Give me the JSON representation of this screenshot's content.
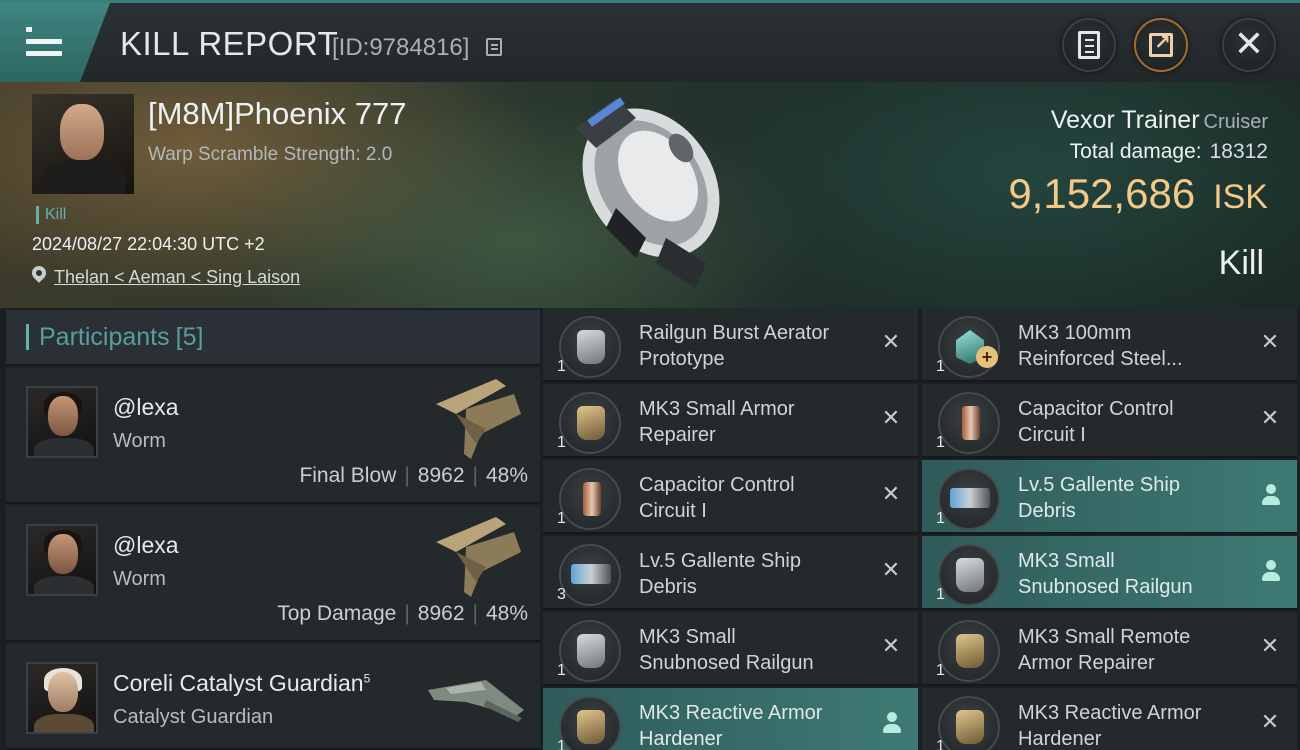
{
  "header": {
    "title": "KILL REPORT",
    "report_id": "[ID:9784816]"
  },
  "victim": {
    "name": "[M8M]Phoenix 777",
    "warp_scramble": "Warp Scramble Strength: 2.0",
    "tag": "Kill",
    "datetime": "2024/08/27 22:04:30 UTC +2",
    "location": "Thelan < Aeman < Sing Laison",
    "ship": "Vexor Trainer",
    "ship_class": "Cruiser",
    "total_damage_label": "Total damage:",
    "total_damage": "18312",
    "isk_value": "9,152,686",
    "isk_unit": "ISK",
    "result": "Kill"
  },
  "participants": {
    "label": "Participants",
    "count": "[5]",
    "rows": [
      {
        "name": "@lexa",
        "ship": "Worm",
        "role": "Final Blow",
        "damage": "8962",
        "percent": "48%"
      },
      {
        "name": "@lexa",
        "ship": "Worm",
        "role": "Top Damage",
        "damage": "8962",
        "percent": "48%"
      },
      {
        "name": "Coreli Catalyst Guardian",
        "sup": "5",
        "ship": "Catalyst Guardian"
      }
    ]
  },
  "items": {
    "left": [
      {
        "name_1": "Railgun Burst Aerator",
        "name_2": "Prototype",
        "qty": "1",
        "action": "✕"
      },
      {
        "name_1": "MK3 Small Armor",
        "name_2": "Repairer",
        "qty": "1",
        "action": "✕"
      },
      {
        "name_1": "Capacitor Control",
        "name_2": "Circuit I",
        "qty": "1",
        "action": "✕"
      },
      {
        "name_1": "Lv.5 Gallente Ship",
        "name_2": "Debris",
        "qty": "3",
        "action": "✕"
      },
      {
        "name_1": "MK3 Small",
        "name_2": "Snubnosed Railgun",
        "qty": "1",
        "action": "✕"
      },
      {
        "name_1": "MK3 Reactive Armor",
        "name_2": "Hardener",
        "qty": "1",
        "action": "person"
      }
    ],
    "right": [
      {
        "name_1": "MK3 100mm",
        "name_2": "Reinforced Steel...",
        "qty": "1",
        "action": "✕"
      },
      {
        "name_1": "Capacitor Control",
        "name_2": "Circuit I",
        "qty": "1",
        "action": "✕"
      },
      {
        "name_1": "Lv.5 Gallente Ship",
        "name_2": "Debris",
        "qty": "1",
        "action": "person"
      },
      {
        "name_1": "MK3 Small",
        "name_2": "Snubnosed Railgun",
        "qty": "1",
        "action": "person"
      },
      {
        "name_1": "MK3 Small Remote",
        "name_2": "Armor Repairer",
        "qty": "1",
        "action": "✕"
      },
      {
        "name_1": "MK3 Reactive Armor",
        "name_2": "Hardener",
        "qty": "1",
        "action": "✕"
      }
    ]
  },
  "colors": {
    "accent_teal": "#3e7a75",
    "isk_gold": "#f3c98a",
    "highlight_row": "#3e7a75"
  }
}
